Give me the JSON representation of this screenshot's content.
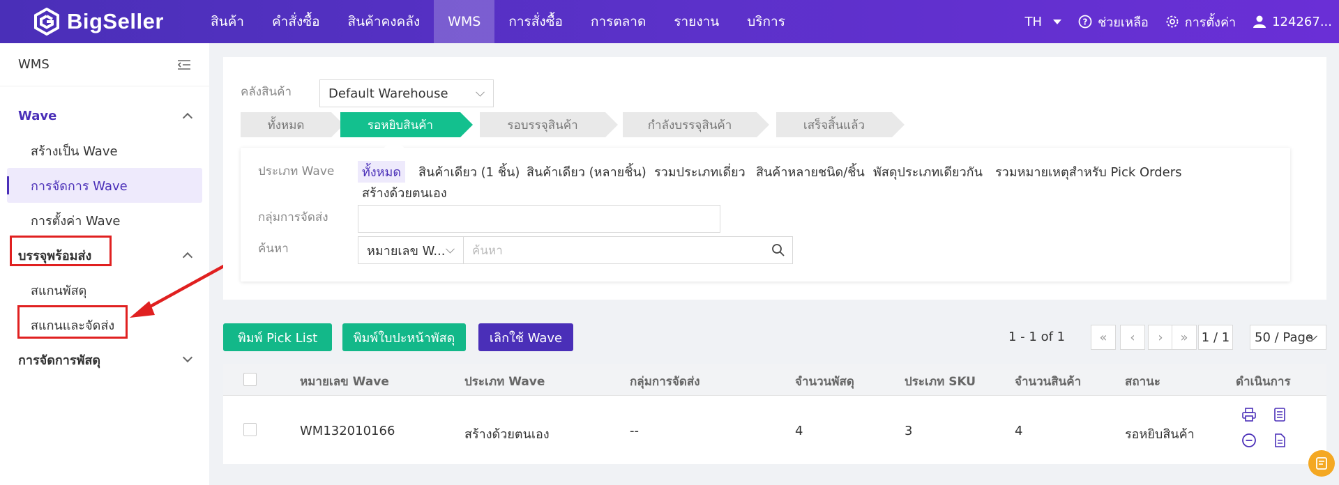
{
  "brand": {
    "name": "BigSeller"
  },
  "nav": {
    "items": [
      "สินค้า",
      "คำสั่งซื้อ",
      "สินค้าคงคลัง",
      "WMS",
      "การสั่งซื้อ",
      "การตลาด",
      "รายงาน",
      "บริการ"
    ],
    "active": "WMS",
    "lang": "TH",
    "help": "ช่วยเหลือ",
    "settings": "การตั้งค่า",
    "user": "124267..."
  },
  "sidebar": {
    "title": "WMS",
    "groups": [
      {
        "label": "Wave",
        "expanded": true,
        "items": [
          "สร้างเป็น Wave",
          "การจัดการ Wave",
          "การตั้งค่า Wave"
        ],
        "active_item": "การจัดการ Wave"
      },
      {
        "label": "บรรจุพร้อมส่ง",
        "expanded": true,
        "items": [
          "สแกนพัสดุ",
          "สแกนและจัดส่ง"
        ]
      },
      {
        "label": "การจัดการพัสดุ",
        "expanded": false,
        "items": []
      }
    ]
  },
  "filter": {
    "warehouse_label": "คลังสินค้า",
    "warehouse_value": "Default Warehouse",
    "steps": [
      "ทั้งหมด",
      "รอหยิบสินค้า",
      "รอบรรจุสินค้า",
      "กำลังบรรจุสินค้า",
      "เสร็จสิ้นแล้ว"
    ],
    "active_step": "รอหยิบสินค้า",
    "wave_type_label": "ประเภท Wave",
    "wave_types": [
      "ทั้งหมด",
      "สินค้าเดียว (1 ชิ้น)",
      "สินค้าเดียว (หลายชิ้น)",
      "รวมประเภทเดี่ยว",
      "สินค้าหลายชนิด/ชิ้น",
      "พัสดุประเภทเดียวกัน",
      "รวมหมายเหตุสำหรับ Pick Orders",
      "สร้างด้วยตนเอง"
    ],
    "active_wave_type": "ทั้งหมด",
    "shipping_group_label": "กลุ่มการจัดส่ง",
    "shipping_group_value": "",
    "search_label": "ค้นหา",
    "search_field": "หมายเลข W...",
    "search_placeholder": "ค้นหา"
  },
  "actions": {
    "print_pick_list": "พิมพ์ Pick List",
    "print_label": "พิมพ์ใบปะหน้าพัสดุ",
    "cancel_wave": "เลิกใช้ Wave"
  },
  "pagination": {
    "summary": "1 - 1 of 1",
    "page": "1 / 1",
    "page_size": "50 / Page"
  },
  "table": {
    "headers": [
      "หมายเลข Wave",
      "ประเภท Wave",
      "กลุ่มการจัดส่ง",
      "จำนวนพัสดุ",
      "ประเภท SKU",
      "จำนวนสินค้า",
      "สถานะ",
      "ดำเนินการ"
    ],
    "rows": [
      {
        "wave_no": "WM132010166",
        "wave_type": "สร้างด้วยตนเอง",
        "shipping_group": "--",
        "parcels": "4",
        "sku_types": "3",
        "items": "4",
        "status": "รอหยิบสินค้า"
      }
    ]
  },
  "colors": {
    "brand": "#4a2fb8",
    "accent_green": "#13c08e",
    "highlight_red": "#e02020"
  }
}
